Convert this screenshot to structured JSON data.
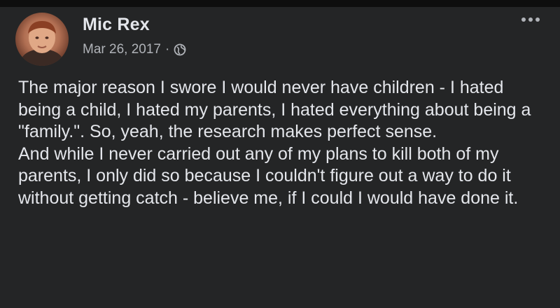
{
  "post": {
    "author_name": "Mic Rex",
    "date": "Mar 26, 2017",
    "separator": "·",
    "privacy_icon": "globe-icon",
    "more_icon": "more-options-icon",
    "paragraphs": [
      "The major reason I swore I would never have children - I hated being a child, I hated my parents, I hated everything about being a \"family.\". So, yeah, the research makes perfect sense.",
      "And while I never carried out any of my plans to kill both of my parents, I only did so because I couldn't figure out a way to do it without getting catch - believe me, if I could I would have done it."
    ]
  },
  "colors": {
    "background": "#242526",
    "primary_text": "#e4e6eb",
    "secondary_text": "#b0b3b8"
  }
}
